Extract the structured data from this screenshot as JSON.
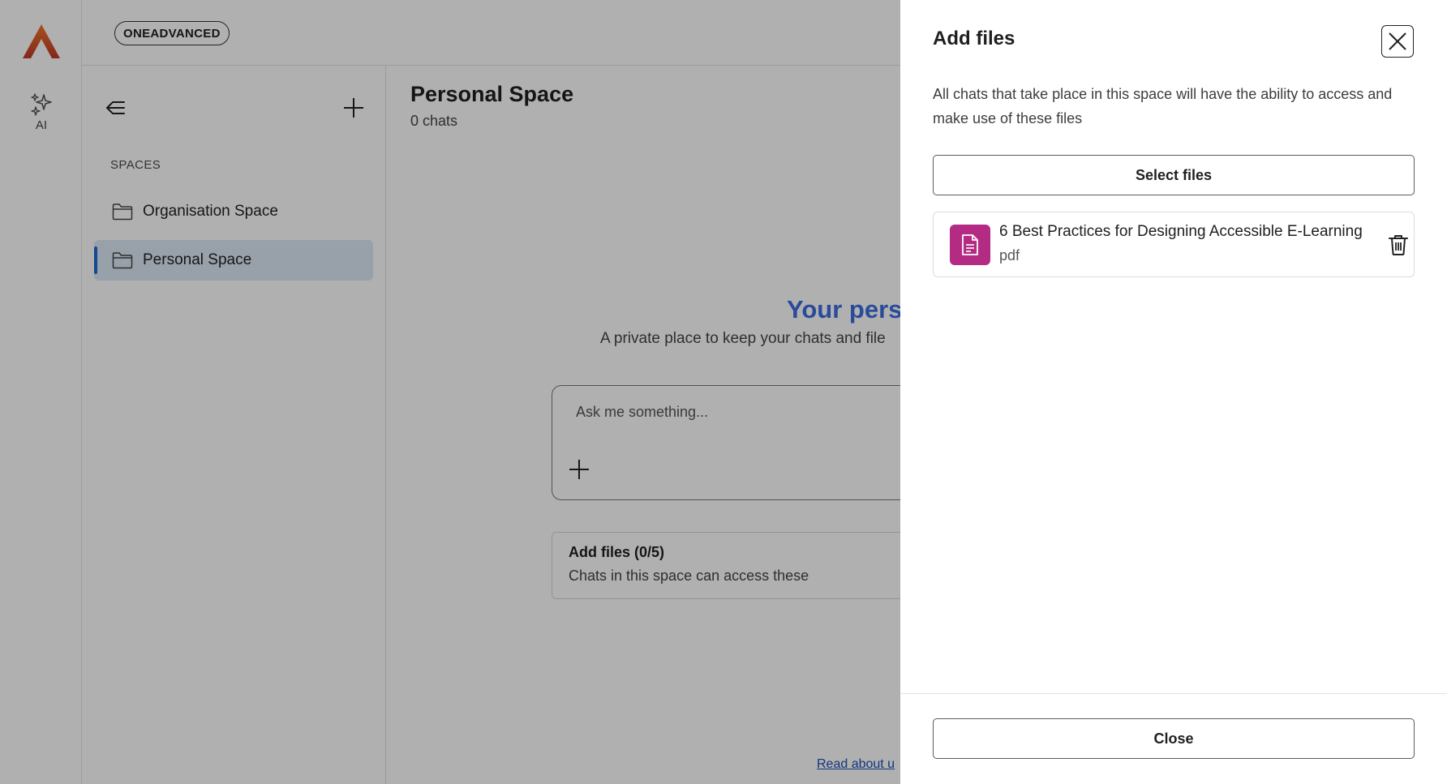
{
  "rail": {
    "logo_color_top": "#f0782a",
    "logo_color_bottom": "#c0392b",
    "ai_label": "AI"
  },
  "header": {
    "brand": "ONEADVANCED"
  },
  "sidebar": {
    "spaces_heading": "SPACES",
    "items": [
      {
        "label": "Organisation Space",
        "active": false
      },
      {
        "label": "Personal Space",
        "active": true
      }
    ]
  },
  "main": {
    "title": "Personal Space",
    "subtitle": "0 chats",
    "hero_title": "Your pers",
    "hero_subtitle": "A private place to keep your chats and file",
    "prompt_placeholder": "Ask me something...",
    "files_card_title": "Add files (0/5)",
    "files_card_subtitle": "Chats in this space can access these",
    "read_link": "Read about u"
  },
  "panel": {
    "title": "Add files",
    "description": "All chats that take place in this space will have the ability to access and make use of these files",
    "select_button": "Select files",
    "files": [
      {
        "name": "6 Best Practices for Designing Accessible E-Learning",
        "type": "pdf",
        "icon_color": "#b42b84"
      }
    ],
    "close_button": "Close"
  },
  "colors": {
    "accent": "#1b6ad6",
    "hero": "#3d6ce0",
    "file_icon": "#b42b84"
  }
}
